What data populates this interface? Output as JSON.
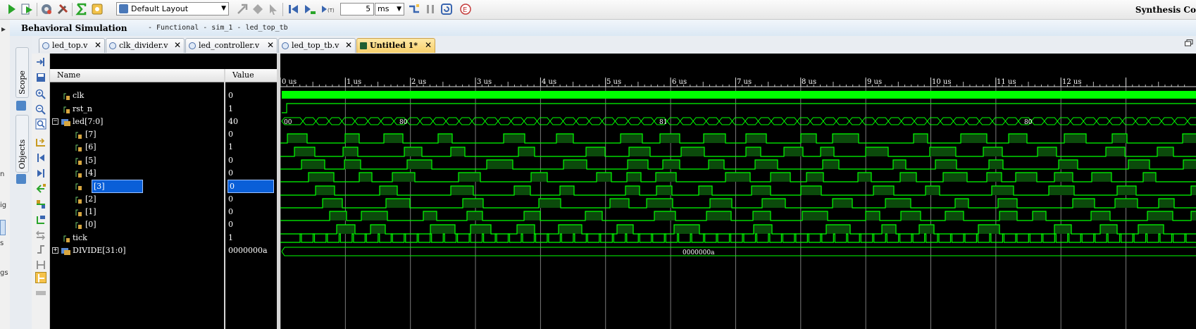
{
  "toolbar": {
    "layout": "Default Layout",
    "run_time": "5",
    "run_unit": "ms",
    "right_label": "Synthesis Co"
  },
  "left_strip_letters": [
    "n",
    "ig",
    "s",
    "gs"
  ],
  "header": {
    "title": "Behavioral Simulation",
    "subtitle": "- Functional - sim_1 - led_top_tb"
  },
  "side_tabs": [
    "Scope",
    "Objects"
  ],
  "tabs": [
    {
      "label": "led_top.v",
      "active": false
    },
    {
      "label": "clk_divider.v",
      "active": false
    },
    {
      "label": "led_controller.v",
      "active": false
    },
    {
      "label": "led_top_tb.v",
      "active": false
    },
    {
      "label": "Untitled 1*",
      "active": true
    }
  ],
  "columns": {
    "name": "Name",
    "value": "Value"
  },
  "signals": [
    {
      "name": "clk",
      "value": "0"
    },
    {
      "name": "rst_n",
      "value": "1"
    },
    {
      "name": "led[7:0]",
      "value": "40"
    },
    {
      "name": "[7]",
      "value": "0"
    },
    {
      "name": "[6]",
      "value": "1"
    },
    {
      "name": "[5]",
      "value": "0"
    },
    {
      "name": "[4]",
      "value": "0"
    },
    {
      "name": "[3]",
      "value": "0"
    },
    {
      "name": "[2]",
      "value": "0"
    },
    {
      "name": "[1]",
      "value": "0"
    },
    {
      "name": "[0]",
      "value": "0"
    },
    {
      "name": "tick",
      "value": "1"
    },
    {
      "name": "DIVIDE[31:0]",
      "value": "0000000a"
    }
  ],
  "time_ruler": [
    "0 us",
    "1 us",
    "2 us",
    "3 us",
    "4 us",
    "5 us",
    "6 us",
    "7 us",
    "8 us",
    "9 us",
    "10 us",
    "11 us",
    "12 us"
  ],
  "bus_labels": {
    "led_a": "00",
    "led_b": "80",
    "led_c": "81",
    "led_d": "80",
    "divide": "0000000a"
  },
  "colors": {
    "wave": "#00ff00",
    "wave_fill": "#0b4a0b",
    "grid": "#7a7a7a",
    "selection": "#0a5fd8"
  }
}
